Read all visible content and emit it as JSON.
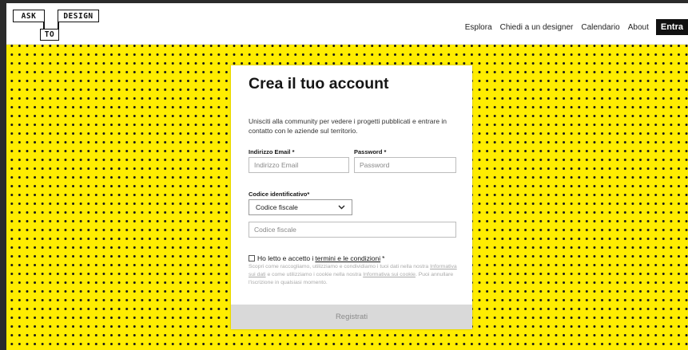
{
  "logo": {
    "word1": "ASK",
    "word2": "DESIGN",
    "word3": "TO"
  },
  "nav": {
    "items": [
      "Esplora",
      "Chiedi a un designer",
      "Calendario",
      "About"
    ],
    "enter_label": "Entra"
  },
  "form": {
    "title": "Crea il tuo account",
    "intro": "Unisciti alla community per vedere i progetti pubblicati e entrare in contatto con le aziende sul territorio.",
    "email_label": "Indirizzo Email *",
    "email_placeholder": "Indirizzo Email",
    "password_label": "Password *",
    "password_placeholder": "Password",
    "code_label": "Codice identificativo*",
    "code_select_value": "Codice fiscale",
    "code_placeholder": "Codice fiscale",
    "consent_prefix": "Ho letto e accetto i",
    "consent_link": "termini e le condizioni",
    "consent_suffix": "*",
    "fine_1": "Scopri come raccogliamo, utilizziamo e condividiamo i tuoi dati nella nostra",
    "fine_link1": "Informativa sui dati",
    "fine_2": "e come utilizziamo i cookie nella nostra",
    "fine_link2": "Informativa sui cookie",
    "fine_3": ". Puoi annullare l'iscrizione in qualsiasi momento.",
    "submit_label": "Registrati"
  },
  "colors": {
    "background": "#ffed00",
    "dots": "#1a1a1a",
    "button_bg": "#d9d9d9",
    "enter_bg": "#111111"
  }
}
